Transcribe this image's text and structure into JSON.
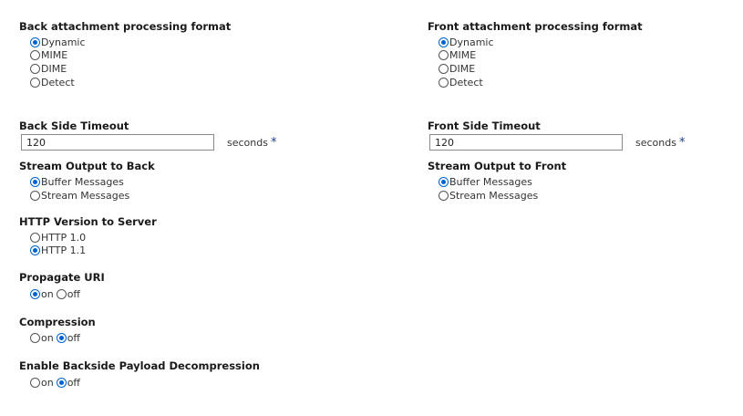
{
  "left": {
    "back_attachment": {
      "label": "Back attachment processing format",
      "options": [
        "Dynamic",
        "MIME",
        "DIME",
        "Detect"
      ],
      "selected": "Dynamic"
    },
    "back_timeout": {
      "label": "Back Side Timeout",
      "value": "120",
      "units": "seconds",
      "required_marker": "*"
    },
    "stream_back": {
      "label": "Stream Output to Back",
      "options": [
        "Buffer Messages",
        "Stream Messages"
      ],
      "selected": "Buffer Messages"
    },
    "http_version": {
      "label": "HTTP Version to Server",
      "options": [
        "HTTP 1.0",
        "HTTP 1.1"
      ],
      "selected": "HTTP 1.1"
    },
    "propagate_uri": {
      "label": "Propagate URI",
      "options": [
        "on",
        "off"
      ],
      "selected": "on"
    },
    "compression": {
      "label": "Compression",
      "options": [
        "on",
        "off"
      ],
      "selected": "off"
    },
    "backside_decompression": {
      "label": "Enable Backside Payload Decompression",
      "options": [
        "on",
        "off"
      ],
      "selected": "off"
    }
  },
  "right": {
    "front_attachment": {
      "label": "Front attachment processing format",
      "options": [
        "Dynamic",
        "MIME",
        "DIME",
        "Detect"
      ],
      "selected": "Dynamic"
    },
    "front_timeout": {
      "label": "Front Side Timeout",
      "value": "120",
      "units": "seconds",
      "required_marker": "*"
    },
    "stream_front": {
      "label": "Stream Output to Front",
      "options": [
        "Buffer Messages",
        "Stream Messages"
      ],
      "selected": "Buffer Messages"
    }
  },
  "colors": {
    "radio_checked": "#0063cc",
    "required": "#1f3c88"
  }
}
